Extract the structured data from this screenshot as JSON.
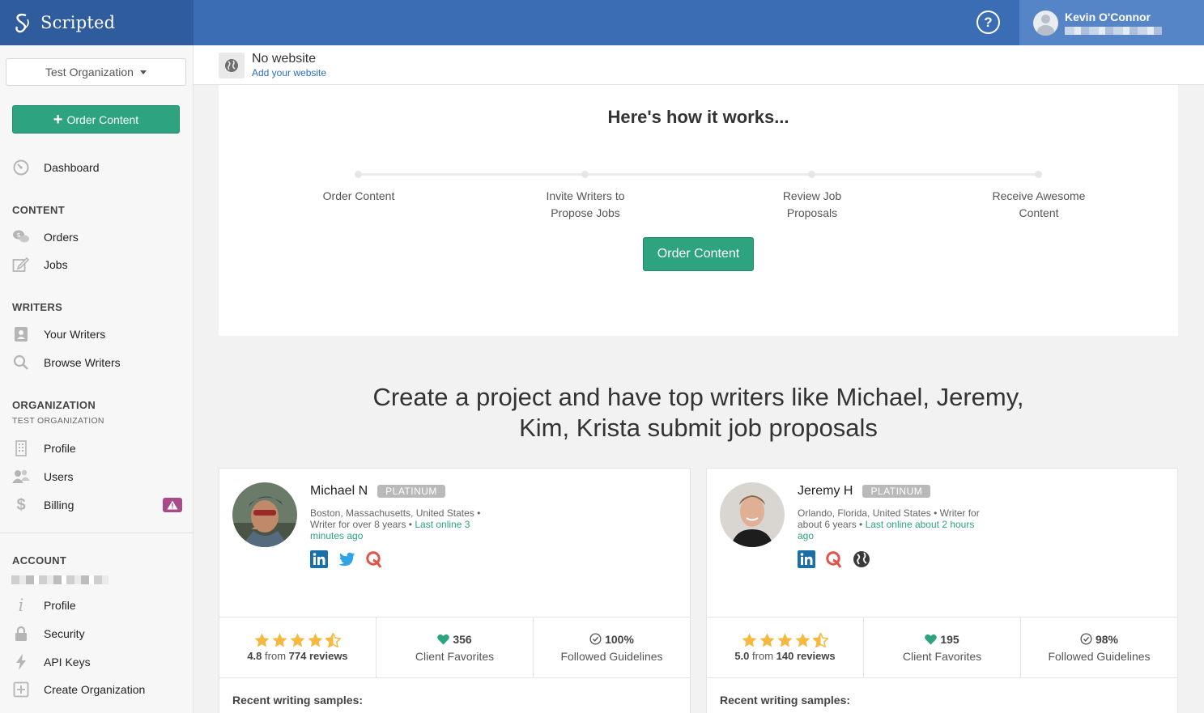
{
  "brand": {
    "name": "Scripted"
  },
  "topbar": {
    "help_glyph": "?",
    "user_name": "Kevin O'Connor"
  },
  "sidebar": {
    "org_selector": "Test Organization",
    "order_button": "Order Content",
    "dashboard": "Dashboard",
    "content_header": "CONTENT",
    "orders": "Orders",
    "jobs": "Jobs",
    "writers_header": "WRITERS",
    "your_writers": "Your Writers",
    "browse_writers": "Browse Writers",
    "org_header": "ORGANIZATION",
    "org_subheader": "TEST ORGANIZATION",
    "org_profile": "Profile",
    "users": "Users",
    "billing": "Billing",
    "account_header": "ACCOUNT",
    "account_profile": "Profile",
    "security": "Security",
    "api_keys": "API Keys",
    "create_org": "Create Organization"
  },
  "website": {
    "title": "No website",
    "link": "Add your website"
  },
  "how": {
    "title": "Here's how it works...",
    "steps": [
      {
        "l1": "Order Content",
        "l2": ""
      },
      {
        "l1": "Invite Writers to",
        "l2": "Propose Jobs"
      },
      {
        "l1": "Review Job",
        "l2": "Proposals"
      },
      {
        "l1": "Receive Awesome",
        "l2": "Content"
      }
    ],
    "button": "Order Content"
  },
  "promo": {
    "line1": "Create a project and have top writers like Michael, Jeremy,",
    "line2": "Kim, Krista submit job proposals"
  },
  "writers": [
    {
      "name": "Michael N",
      "badge": "PLATINUM",
      "loc_l1": "Boston, Massachusetts, United States •",
      "loc_l2": "Writer for over 8 years •",
      "online_l2": " Last online 3",
      "online_l3": "minutes ago",
      "socials": [
        "linkedin-icon",
        "twitter-icon",
        "quora-icon"
      ],
      "rating": "4.8",
      "rating_from": "from",
      "reviews": "774 reviews",
      "favorites": "356",
      "favorites_label": "Client Favorites",
      "guidelines": "100%",
      "guidelines_label": "Followed Guidelines",
      "samples": "Recent writing samples:"
    },
    {
      "name": "Jeremy H",
      "badge": "PLATINUM",
      "loc_l1": "Orlando, Florida, United States • Writer for",
      "loc_l2": "about 6 years •",
      "online_l2": " Last online about 2 hours",
      "online_l3": "ago",
      "socials": [
        "linkedin-icon",
        "quora-icon",
        "globe-icon"
      ],
      "rating": "5.0",
      "rating_from": "from",
      "reviews": "140 reviews",
      "favorites": "195",
      "favorites_label": "Client Favorites",
      "guidelines": "98%",
      "guidelines_label": "Followed Guidelines",
      "samples": "Recent writing samples:"
    }
  ],
  "colors": {
    "primary_blue": "#3a6db3",
    "accent_green": "#2da37f",
    "star": "#f5b942",
    "billing_warning": "#a94a8d"
  }
}
